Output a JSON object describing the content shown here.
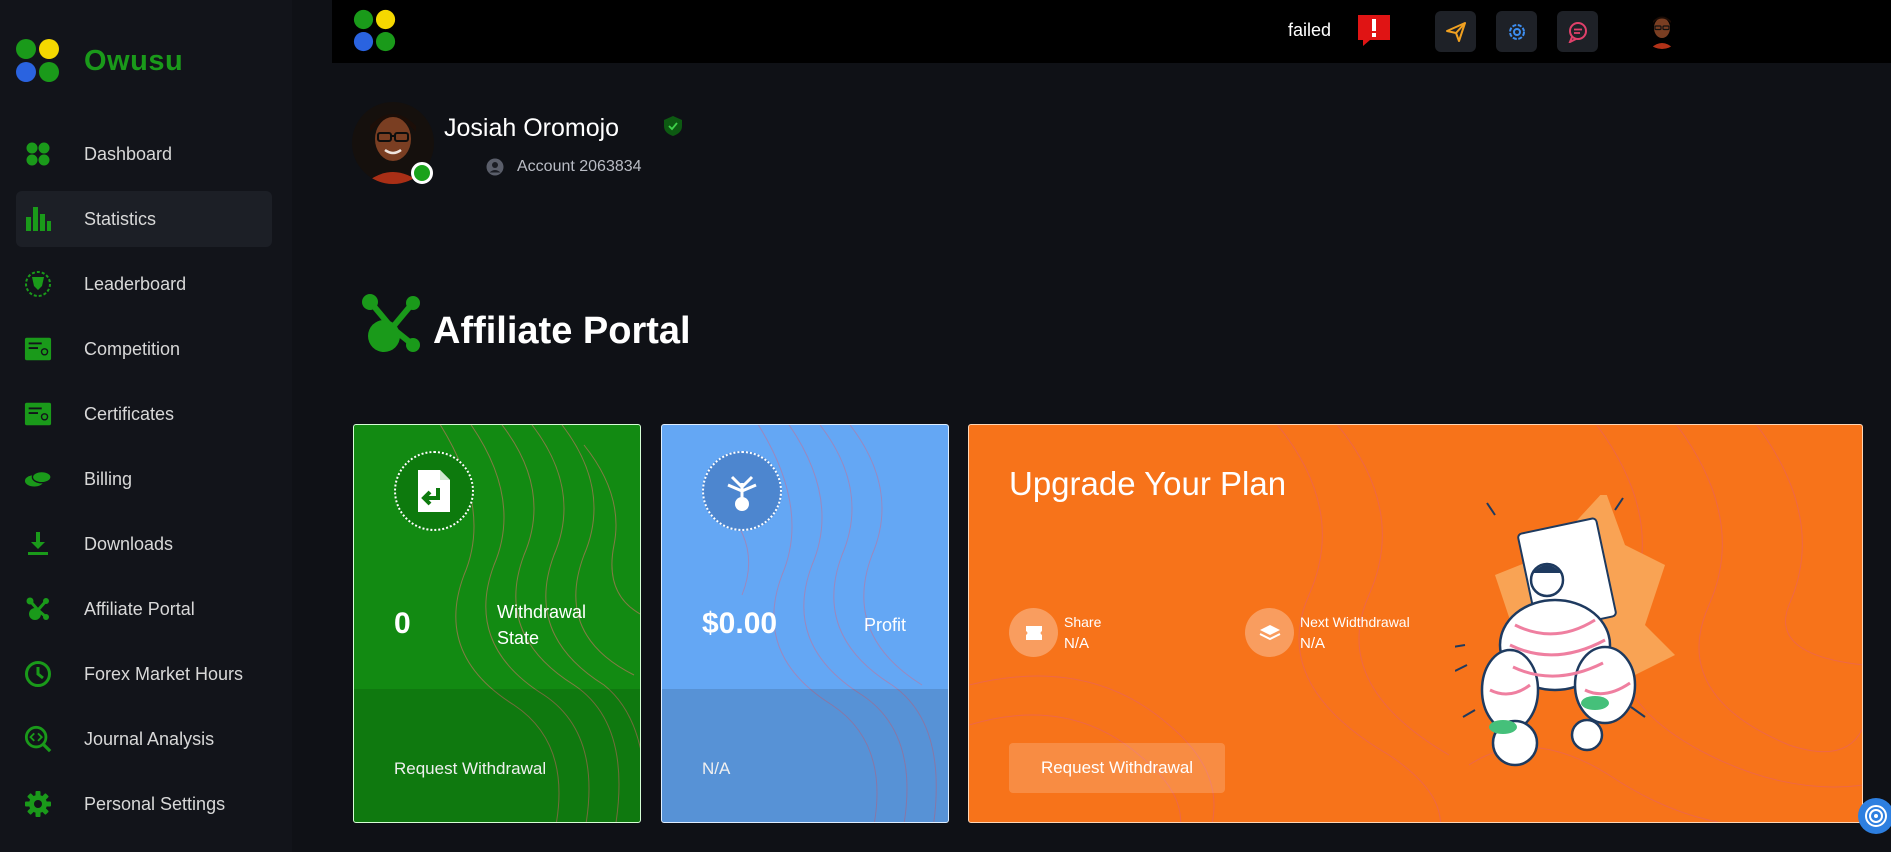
{
  "brand": {
    "name": "Owusu"
  },
  "sidebar": {
    "items": [
      {
        "label": "Dashboard",
        "icon": "dashboard-icon"
      },
      {
        "label": "Statistics",
        "icon": "bar-chart-icon",
        "active": true
      },
      {
        "label": "Leaderboard",
        "icon": "award-icon"
      },
      {
        "label": "Competition",
        "icon": "certificate-icon"
      },
      {
        "label": "Certificates",
        "icon": "certificate-icon"
      },
      {
        "label": "Billing",
        "icon": "coins-icon"
      },
      {
        "label": "Downloads",
        "icon": "download-icon"
      },
      {
        "label": "Affiliate Portal",
        "icon": "network-icon"
      },
      {
        "label": "Forex Market Hours",
        "icon": "clock-icon"
      },
      {
        "label": "Journal Analysis",
        "icon": "analysis-icon"
      },
      {
        "label": "Personal Settings",
        "icon": "gear-icon"
      }
    ]
  },
  "topbar": {
    "status": "failed",
    "alert_icon": "alert-icon",
    "buttons": [
      "send-icon",
      "settings-icon",
      "chat-icon"
    ]
  },
  "profile": {
    "name": "Josiah Oromojo",
    "account": "Account 2063834"
  },
  "page": {
    "title": "Affiliate Portal"
  },
  "cards": {
    "withdrawal": {
      "value": "0",
      "label": "Withdrawal State",
      "footer": "Request Withdrawal"
    },
    "profit": {
      "value": "$0.00",
      "label": "Profit",
      "footer": "N/A"
    },
    "upgrade": {
      "title": "Upgrade Your Plan",
      "share_label": "Share",
      "share_value": "N/A",
      "next_label": "Next Widthdrawal",
      "next_value": "N/A",
      "button": "Request Withdrawal"
    }
  },
  "colors": {
    "accent_green": "#1a9a1a",
    "card_green": "#128a12",
    "card_blue": "#64a7f4",
    "card_orange": "#f7731a",
    "alert_red": "#e01414"
  }
}
